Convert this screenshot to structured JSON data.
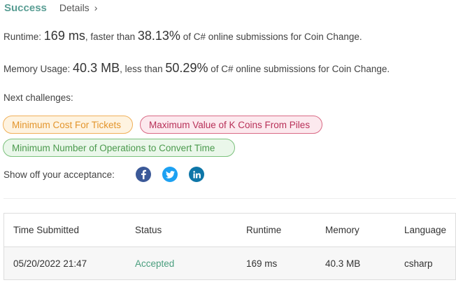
{
  "header": {
    "status": "Success",
    "details_label": "Details",
    "chevron": "›"
  },
  "runtime": {
    "label": "Runtime:",
    "value": "169 ms",
    "comparison_text": ", faster than",
    "percent": "38.13%",
    "suffix": "of C# online submissions for Coin Change."
  },
  "memory": {
    "label": "Memory Usage:",
    "value": "40.3 MB",
    "comparison_text": ", less than",
    "percent": "50.29%",
    "suffix": "of C# online submissions for Coin Change."
  },
  "next_challenges": {
    "label": "Next challenges:",
    "items": [
      {
        "label": "Minimum Cost For Tickets",
        "difficulty_color": "#e3952c"
      },
      {
        "label": "Maximum Value of K Coins From Piles",
        "difficulty_color": "#b83058"
      },
      {
        "label": "Minimum Number of Operations to Convert Time",
        "difficulty_color": "#4b9a4d"
      }
    ]
  },
  "share": {
    "label": "Show off your acceptance:",
    "icons": [
      "facebook-icon",
      "twitter-icon",
      "linkedin-icon"
    ]
  },
  "table": {
    "headers": [
      "Time Submitted",
      "Status",
      "Runtime",
      "Memory",
      "Language"
    ],
    "rows": [
      [
        "05/20/2022 21:47",
        "Accepted",
        "169 ms",
        "40.3 MB",
        "csharp"
      ]
    ]
  }
}
